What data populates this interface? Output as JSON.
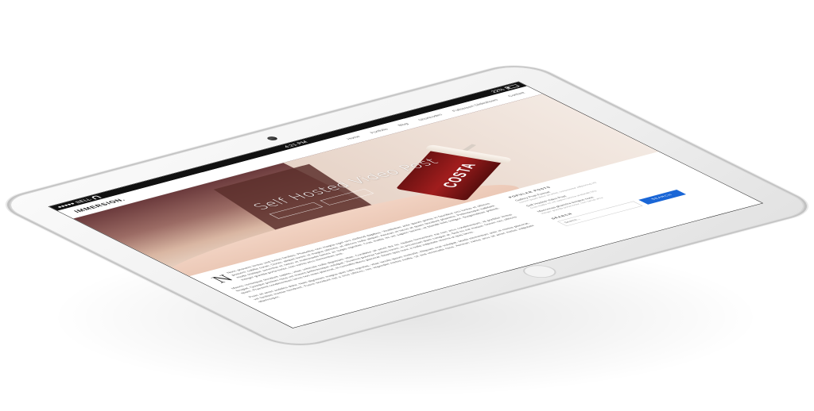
{
  "status_bar": {
    "carrier": "BELL",
    "time": "4:21 PM",
    "battery": "22%"
  },
  "site": {
    "logo": "IMMERSION.",
    "nav": [
      "Home",
      "Portfolio",
      "Blog",
      "Shortcodes",
      "Fullscreen Slideshows",
      "Contact"
    ]
  },
  "hero": {
    "title": "Self Hosted Video Post",
    "cup_brand": "COSTA"
  },
  "article": {
    "dropcap": "N",
    "paragraphs": [
      "Nunc posuere lectus sed luctus facilisis. Phasellus non magna eget orci eleifend dapibus. Vestibulum ante ipsum primis in faucibus orci luctus et ultrices posuere cubilia curae; Donec aliquet lorem ut magna ultricies, at ultrices nulla aliquet. Aenean et lacus at quam tincidunt pharetra. Pellentesque habitant morbi tristique senectus et netus et malesuada fames ac turpis egestas. Cras mattis mi vel sapien lacinia, ut blandit felis tempor. Suspendisse potenti. Integer gravida porta tortor, non varius arcu elementum sed.",
      "Mauris consequat tincidunt sapien, vitae vehicula nulla dignissim vitae. Curabitur sit amet dui mi. Nullam fermentum est non arcu condimentum, id porttitor lectus feugiat. Quisque pretium risus vel mauris pellentesque volutpat. Vivamus pulvinar facilisis lorem, in accumsan diam congue at. Sed eu est massa. Donec nec ultrices quam. Praesent condimentum lacus non enim placerat, et convallis libero placerat. Etiam quis nunc a nulla vulputate viverra ut quis lacus.",
      "Proin sit amet sodales dolor. Nam dignissim magna quis odio egestas, vitae iaculis ipsum molestie. Aliquam erat volutpat. Morbi elementum ante et metus placerat, vel facilisis massa hendrerit. Fusce tincidunt est a eros ultrices, nec imperdiet metus mollis. Ut sed venenatis risus. Aenean varius arcu sit amet metus vulputate ullamcorper."
    ]
  },
  "sidebar": {
    "popular_posts_title": "POPULAR POSTS",
    "posts": [
      {
        "title": "Gallery Post Format",
        "meta": "Lorem ipsum dolor sit amet, consectetur adipiscing elit"
      },
      {
        "title": "Self Hosted Video Post",
        "meta": "Cras mattis mi vel sapien lacinia ut blandit felis"
      },
      {
        "title": "Maecenas pharetra tempus nunc",
        "meta": "Integer gravida porta tortor, non varius arcu"
      }
    ],
    "search_title": "SEARCH",
    "search_placeholder": "Search...",
    "search_button": "SEARCH"
  }
}
